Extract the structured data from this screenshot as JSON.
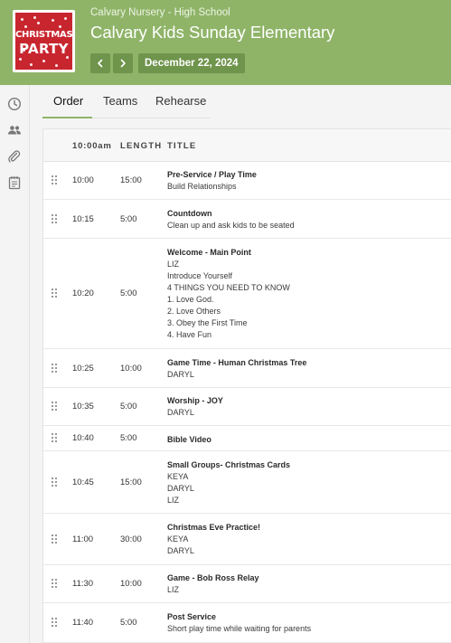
{
  "header": {
    "org": "Calvary Nursery - High School",
    "title": "Calvary Kids Sunday Elementary",
    "date": "December 22, 2024",
    "logo": {
      "line1": "CHRISTMAS",
      "line2": "PARTY",
      "bg_color": "#c8262f"
    },
    "prev_icon": "chevron-left-icon",
    "next_icon": "chevron-right-icon",
    "brand_color": "#8fb468"
  },
  "sidebar": {
    "icons": [
      "clock-icon",
      "people-icon",
      "paperclip-icon",
      "notes-icon"
    ]
  },
  "tabs": [
    {
      "label": "Order",
      "active": true
    },
    {
      "label": "Teams",
      "active": false
    },
    {
      "label": "Rehearse",
      "active": false
    }
  ],
  "table": {
    "columns": {
      "time": "10:00am",
      "length": "LENGTH",
      "title": "TITLE"
    },
    "rows": [
      {
        "time": "10:00",
        "length": "15:00",
        "title": "Pre-Service / Play Time",
        "lines": [
          "Build Relationships"
        ]
      },
      {
        "time": "10:15",
        "length": "5:00",
        "title": "Countdown",
        "lines": [
          "Clean up and ask kids to be seated"
        ]
      },
      {
        "time": "10:20",
        "length": "5:00",
        "title": "Welcome - Main Point",
        "lines": [
          "LIZ",
          "Introduce Yourself",
          "4 THINGS YOU NEED TO KNOW",
          "1. Love God.",
          "2. Love Others",
          "3. Obey the First Time",
          "4. Have Fun"
        ]
      },
      {
        "time": "10:25",
        "length": "10:00",
        "title": "Game Time - Human Christmas Tree",
        "lines": [
          "DARYL"
        ]
      },
      {
        "time": "10:35",
        "length": "5:00",
        "title": "Worship - JOY",
        "lines": [
          "DARYL"
        ]
      },
      {
        "time": "10:40",
        "length": "5:00",
        "title": "Bible Video",
        "lines": []
      },
      {
        "time": "10:45",
        "length": "15:00",
        "title": "Small Groups- Christmas Cards",
        "lines": [
          "KEYA",
          "DARYL",
          "LIZ"
        ]
      },
      {
        "time": "11:00",
        "length": "30:00",
        "title": "Christmas Eve Practice!",
        "lines": [
          "KEYA",
          "DARYL"
        ]
      },
      {
        "time": "11:30",
        "length": "10:00",
        "title": "Game - Bob Ross Relay",
        "lines": [
          "LIZ"
        ]
      },
      {
        "time": "11:40",
        "length": "5:00",
        "title": "Post Service",
        "lines": [
          "Short play time while waiting for parents"
        ]
      }
    ]
  }
}
